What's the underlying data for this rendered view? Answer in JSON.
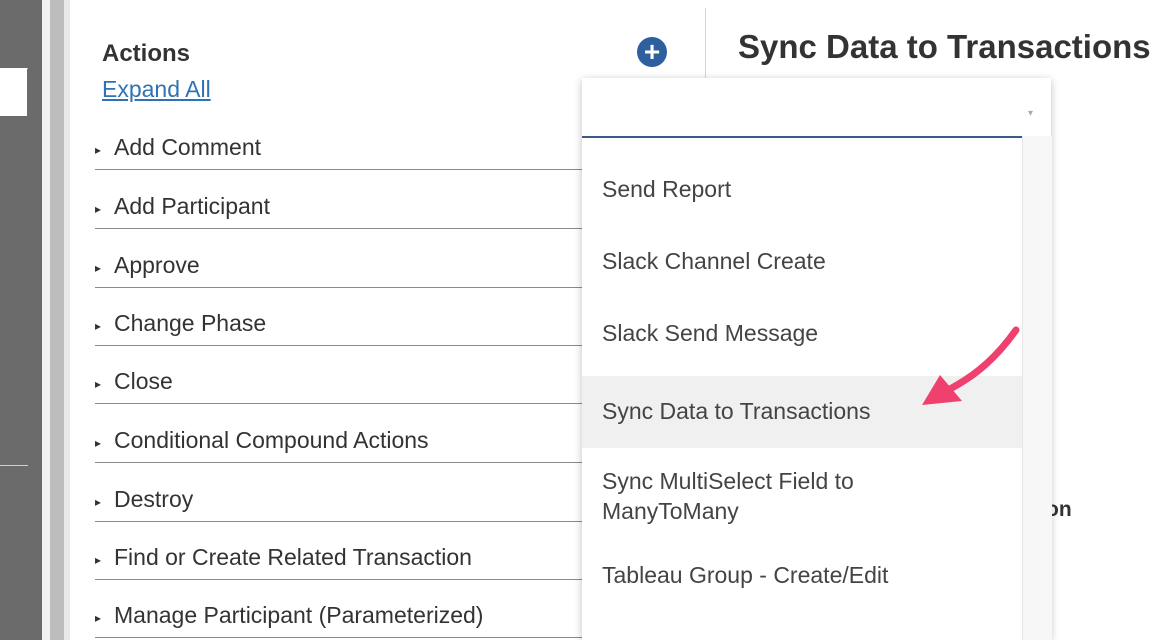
{
  "panel": {
    "title": "Actions",
    "expand_all": "Expand All",
    "items": [
      "Add Comment",
      "Add Participant",
      "Approve",
      "Change Phase",
      "Close",
      "Conditional Compound Actions",
      "Destroy",
      "Find or Create Related Transaction",
      "Manage Participant (Parameterized)"
    ],
    "caret": "▸"
  },
  "add_icon": "+",
  "detail": {
    "title": "Sync Data to Transactions",
    "partial_label": "on"
  },
  "dropdown": {
    "selected_value": "",
    "arrow": "▾",
    "options": [
      "Send Report",
      "Slack Channel Create",
      "Slack Send Message",
      "Sync Data to Transactions",
      "Sync MultiSelect Field to ManyToMany",
      "Tableau Group - Create/Edit"
    ],
    "highlighted_option": "Sync Data to Transactions"
  },
  "colors": {
    "link": "#2f73b6",
    "add_button": "#2e5f9e",
    "annotation_arrow": "#f0406e",
    "select_underline": "#3b5a86"
  }
}
